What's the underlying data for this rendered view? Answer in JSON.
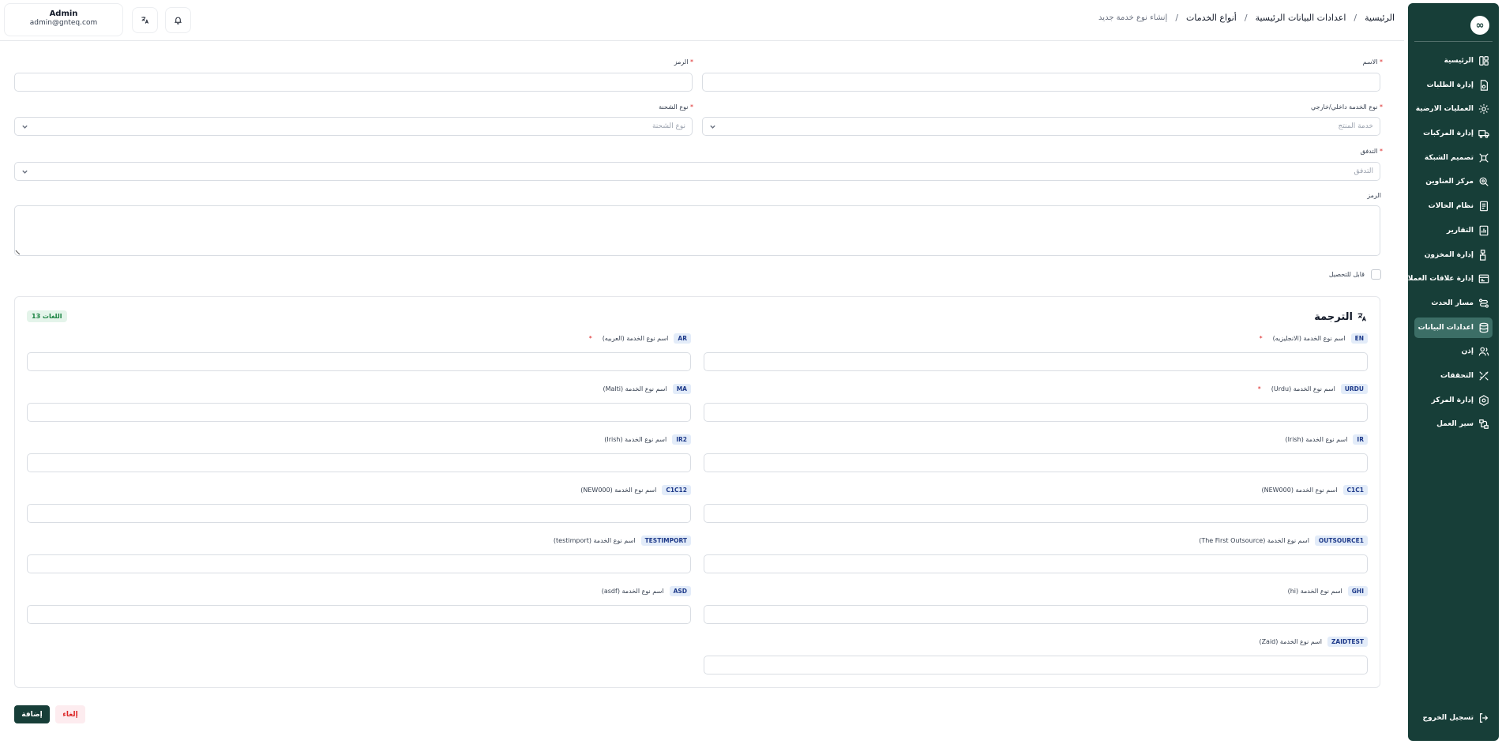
{
  "header": {
    "user_name": "Admin",
    "user_email": "admin@gnteq.com",
    "breadcrumb": [
      "الرئيسية",
      "اعدادات البيانات الرئيسية",
      "أنواع الخدمات",
      "إنشاء نوع خدمة جديد"
    ]
  },
  "sidebar": {
    "logo": "∞",
    "items": [
      {
        "label": "الرئيسية",
        "icon": "dashboard-icon"
      },
      {
        "label": "إدارة الطلبات",
        "icon": "orders-icon"
      },
      {
        "label": "العمليات الارضية",
        "icon": "ground-ops-icon"
      },
      {
        "label": "إدارة المركبات",
        "icon": "truck-icon"
      },
      {
        "label": "تصميم الشبكة",
        "icon": "network-icon"
      },
      {
        "label": "مركز العناوين",
        "icon": "address-icon"
      },
      {
        "label": "نظام الحالات",
        "icon": "status-icon"
      },
      {
        "label": "التقارير",
        "icon": "reports-icon"
      },
      {
        "label": "إدارة المخزون",
        "icon": "inventory-icon"
      },
      {
        "label": "إدارة علاقات العملاء",
        "icon": "crm-icon"
      },
      {
        "label": "مسار الحدث",
        "icon": "event-path-icon"
      },
      {
        "label": "اعدادات البيانات",
        "icon": "database-icon",
        "active": true
      },
      {
        "label": "إذن",
        "icon": "users-icon"
      },
      {
        "label": "التحققات",
        "icon": "validation-icon"
      },
      {
        "label": "إدارة المركز",
        "icon": "center-icon"
      },
      {
        "label": "سير العمل",
        "icon": "workflow-icon"
      }
    ],
    "logout": "تسجيل الخروج"
  },
  "form": {
    "name_label": "الاسم",
    "code_label": "الرمز",
    "service_type_label": "نوع الخدمة داخلي/خارجي",
    "service_type_placeholder": "خدمة المنتج",
    "shipment_type_label": "نوع الشحنة",
    "shipment_type_placeholder": "نوع الشحنة",
    "flow_label": "التدفق",
    "flow_placeholder": "التدفق",
    "description_label": "الرمز",
    "collectible_label": "قابل للتحصيل",
    "required_mark": "*"
  },
  "translation": {
    "title": "الترجمة",
    "count_badge": "13 اللغات",
    "fields": [
      {
        "code": "EN",
        "label": "اسم نوع الخدمة (الانجليزيه)",
        "required": true
      },
      {
        "code": "AR",
        "label": "اسم نوع الخدمة (العربيه)",
        "required": true
      },
      {
        "code": "URDU",
        "label": "اسم نوع الخدمة (Urdu)",
        "required": true
      },
      {
        "code": "MA",
        "label": "اسم نوع الخدمة (Malti)",
        "required": false
      },
      {
        "code": "IR",
        "label": "اسم نوع الخدمة (Irish)",
        "required": false
      },
      {
        "code": "IR2",
        "label": "اسم نوع الخدمة (Irish)",
        "required": false
      },
      {
        "code": "C1C1",
        "label": "اسم نوع الخدمة (NEW000)",
        "required": false
      },
      {
        "code": "C1C12",
        "label": "اسم نوع الخدمة (NEW000)",
        "required": false
      },
      {
        "code": "OUTSOURCE1",
        "label": "اسم نوع الخدمة (The First Outsource)",
        "required": false
      },
      {
        "code": "TESTIMPORT",
        "label": "اسم نوع الخدمة (testimport)",
        "required": false
      },
      {
        "code": "GHI",
        "label": "اسم نوع الخدمة (hi)",
        "required": false
      },
      {
        "code": "ASD",
        "label": "اسم نوع الخدمة (asdf)",
        "required": false
      },
      {
        "code": "ZAIDTEST",
        "label": "اسم نوع الخدمة (Zaid)",
        "required": false
      }
    ]
  },
  "actions": {
    "add": "إضافة",
    "cancel": "إلغاء"
  }
}
